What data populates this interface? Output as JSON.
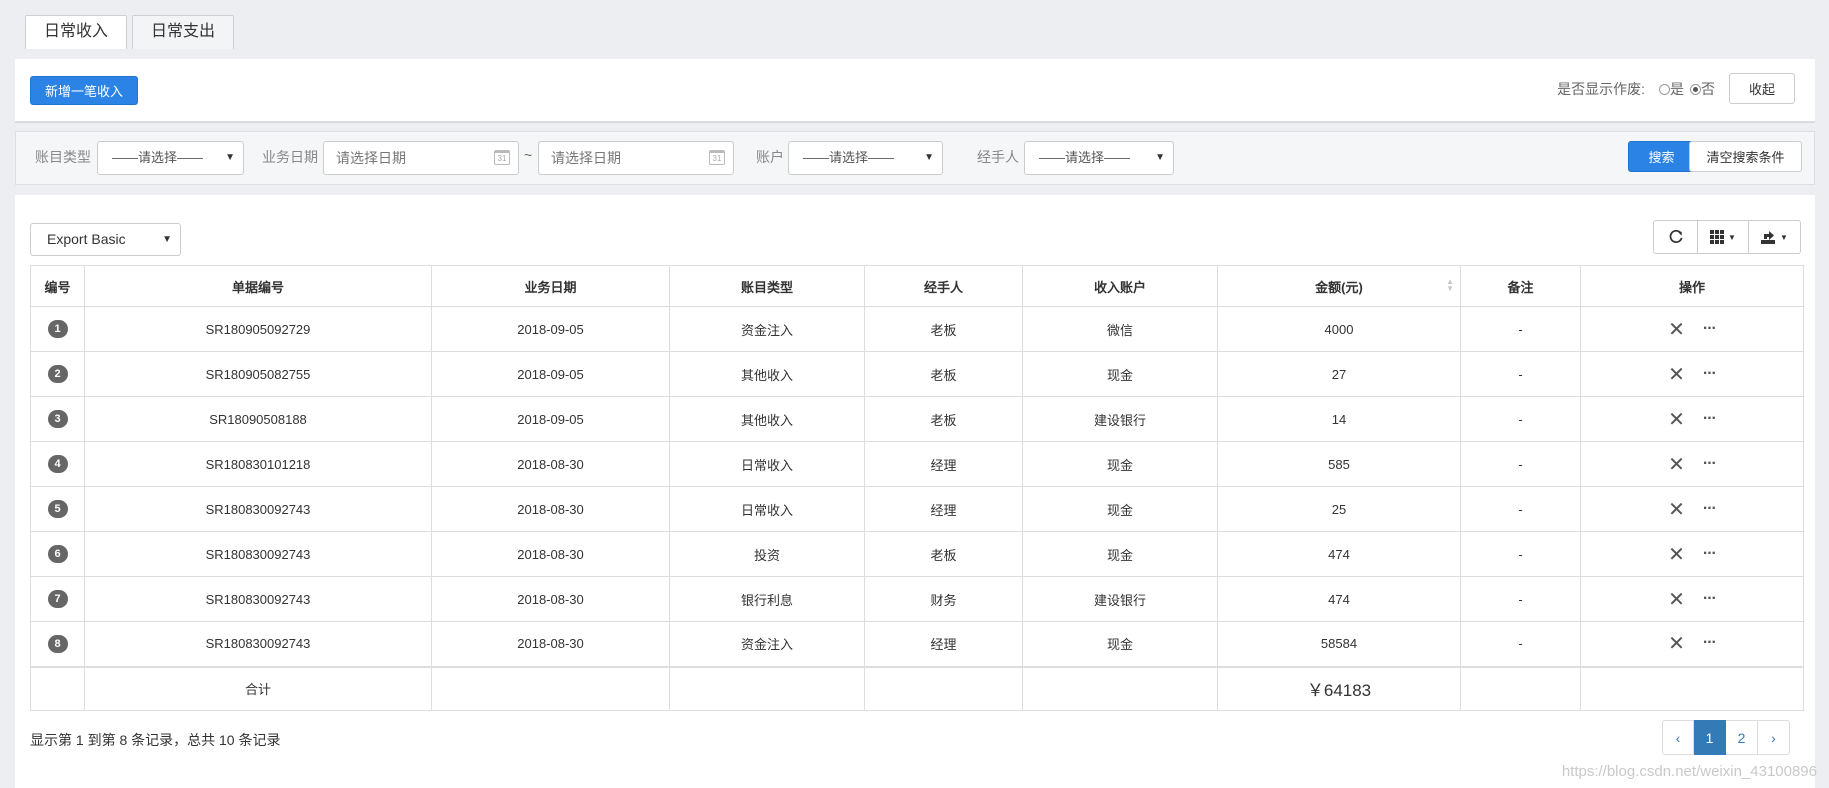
{
  "tabs": [
    {
      "label": "日常收入",
      "active": true
    },
    {
      "label": "日常支出",
      "active": false
    }
  ],
  "toolbar": {
    "add_label": "新增一笔收入",
    "show_void_label": "是否显示作废:",
    "radio_yes": "是",
    "radio_no": "否",
    "selected": "否",
    "collapse_label": "收起"
  },
  "search": {
    "type_label": "账目类型",
    "type_value": "——请选择——",
    "date_label": "业务日期",
    "date_from_placeholder": "请选择日期",
    "date_sep": "~",
    "date_to_placeholder": "请选择日期",
    "account_label": "账户",
    "account_value": "——请选择——",
    "handler_label": "经手人",
    "handler_value": "——请选择——",
    "search_label": "搜索",
    "clear_label": "清空搜索条件"
  },
  "export": {
    "value": "Export Basic"
  },
  "table": {
    "headers": [
      "编号",
      "单据编号",
      "业务日期",
      "账目类型",
      "经手人",
      "收入账户",
      "金额(元)",
      "备注",
      "操作"
    ],
    "rows": [
      {
        "no": "1",
        "doc": "SR180905092729",
        "date": "2018-09-05",
        "type": "资金注入",
        "handler": "老板",
        "account": "微信",
        "amount": "4000",
        "note": "-"
      },
      {
        "no": "2",
        "doc": "SR180905082755",
        "date": "2018-09-05",
        "type": "其他收入",
        "handler": "老板",
        "account": "现金",
        "amount": "27",
        "note": "-"
      },
      {
        "no": "3",
        "doc": "SR18090508188",
        "date": "2018-09-05",
        "type": "其他收入",
        "handler": "老板",
        "account": "建设银行",
        "amount": "14",
        "note": "-"
      },
      {
        "no": "4",
        "doc": "SR180830101218",
        "date": "2018-08-30",
        "type": "日常收入",
        "handler": "经理",
        "account": "现金",
        "amount": "585",
        "note": "-"
      },
      {
        "no": "5",
        "doc": "SR180830092743",
        "date": "2018-08-30",
        "type": "日常收入",
        "handler": "经理",
        "account": "现金",
        "amount": "25",
        "note": "-"
      },
      {
        "no": "6",
        "doc": "SR180830092743",
        "date": "2018-08-30",
        "type": "投资",
        "handler": "老板",
        "account": "现金",
        "amount": "474",
        "note": "-"
      },
      {
        "no": "7",
        "doc": "SR180830092743",
        "date": "2018-08-30",
        "type": "银行利息",
        "handler": "财务",
        "account": "建设银行",
        "amount": "474",
        "note": "-"
      },
      {
        "no": "8",
        "doc": "SR180830092743",
        "date": "2018-08-30",
        "type": "资金注入",
        "handler": "经理",
        "account": "现金",
        "amount": "58584",
        "note": "-"
      }
    ],
    "total_label": "合计",
    "total_amount": "￥64183"
  },
  "footer": {
    "info": "显示第 1 到第 8 条记录，总共 10 条记录",
    "pages": [
      "‹",
      "1",
      "2",
      "›"
    ],
    "active_page": "1"
  },
  "watermark": "https://blog.csdn.net/weixin_43100896",
  "colors": {
    "primary": "#2b84e5",
    "total": "#e02020",
    "pager_active": "#337ab7"
  },
  "icons": {
    "refresh": "refresh-icon",
    "columns": "columns-grid-icon",
    "export": "export-icon",
    "delete": "close-icon",
    "more": "more-icon",
    "calendar": "calendar-icon"
  }
}
